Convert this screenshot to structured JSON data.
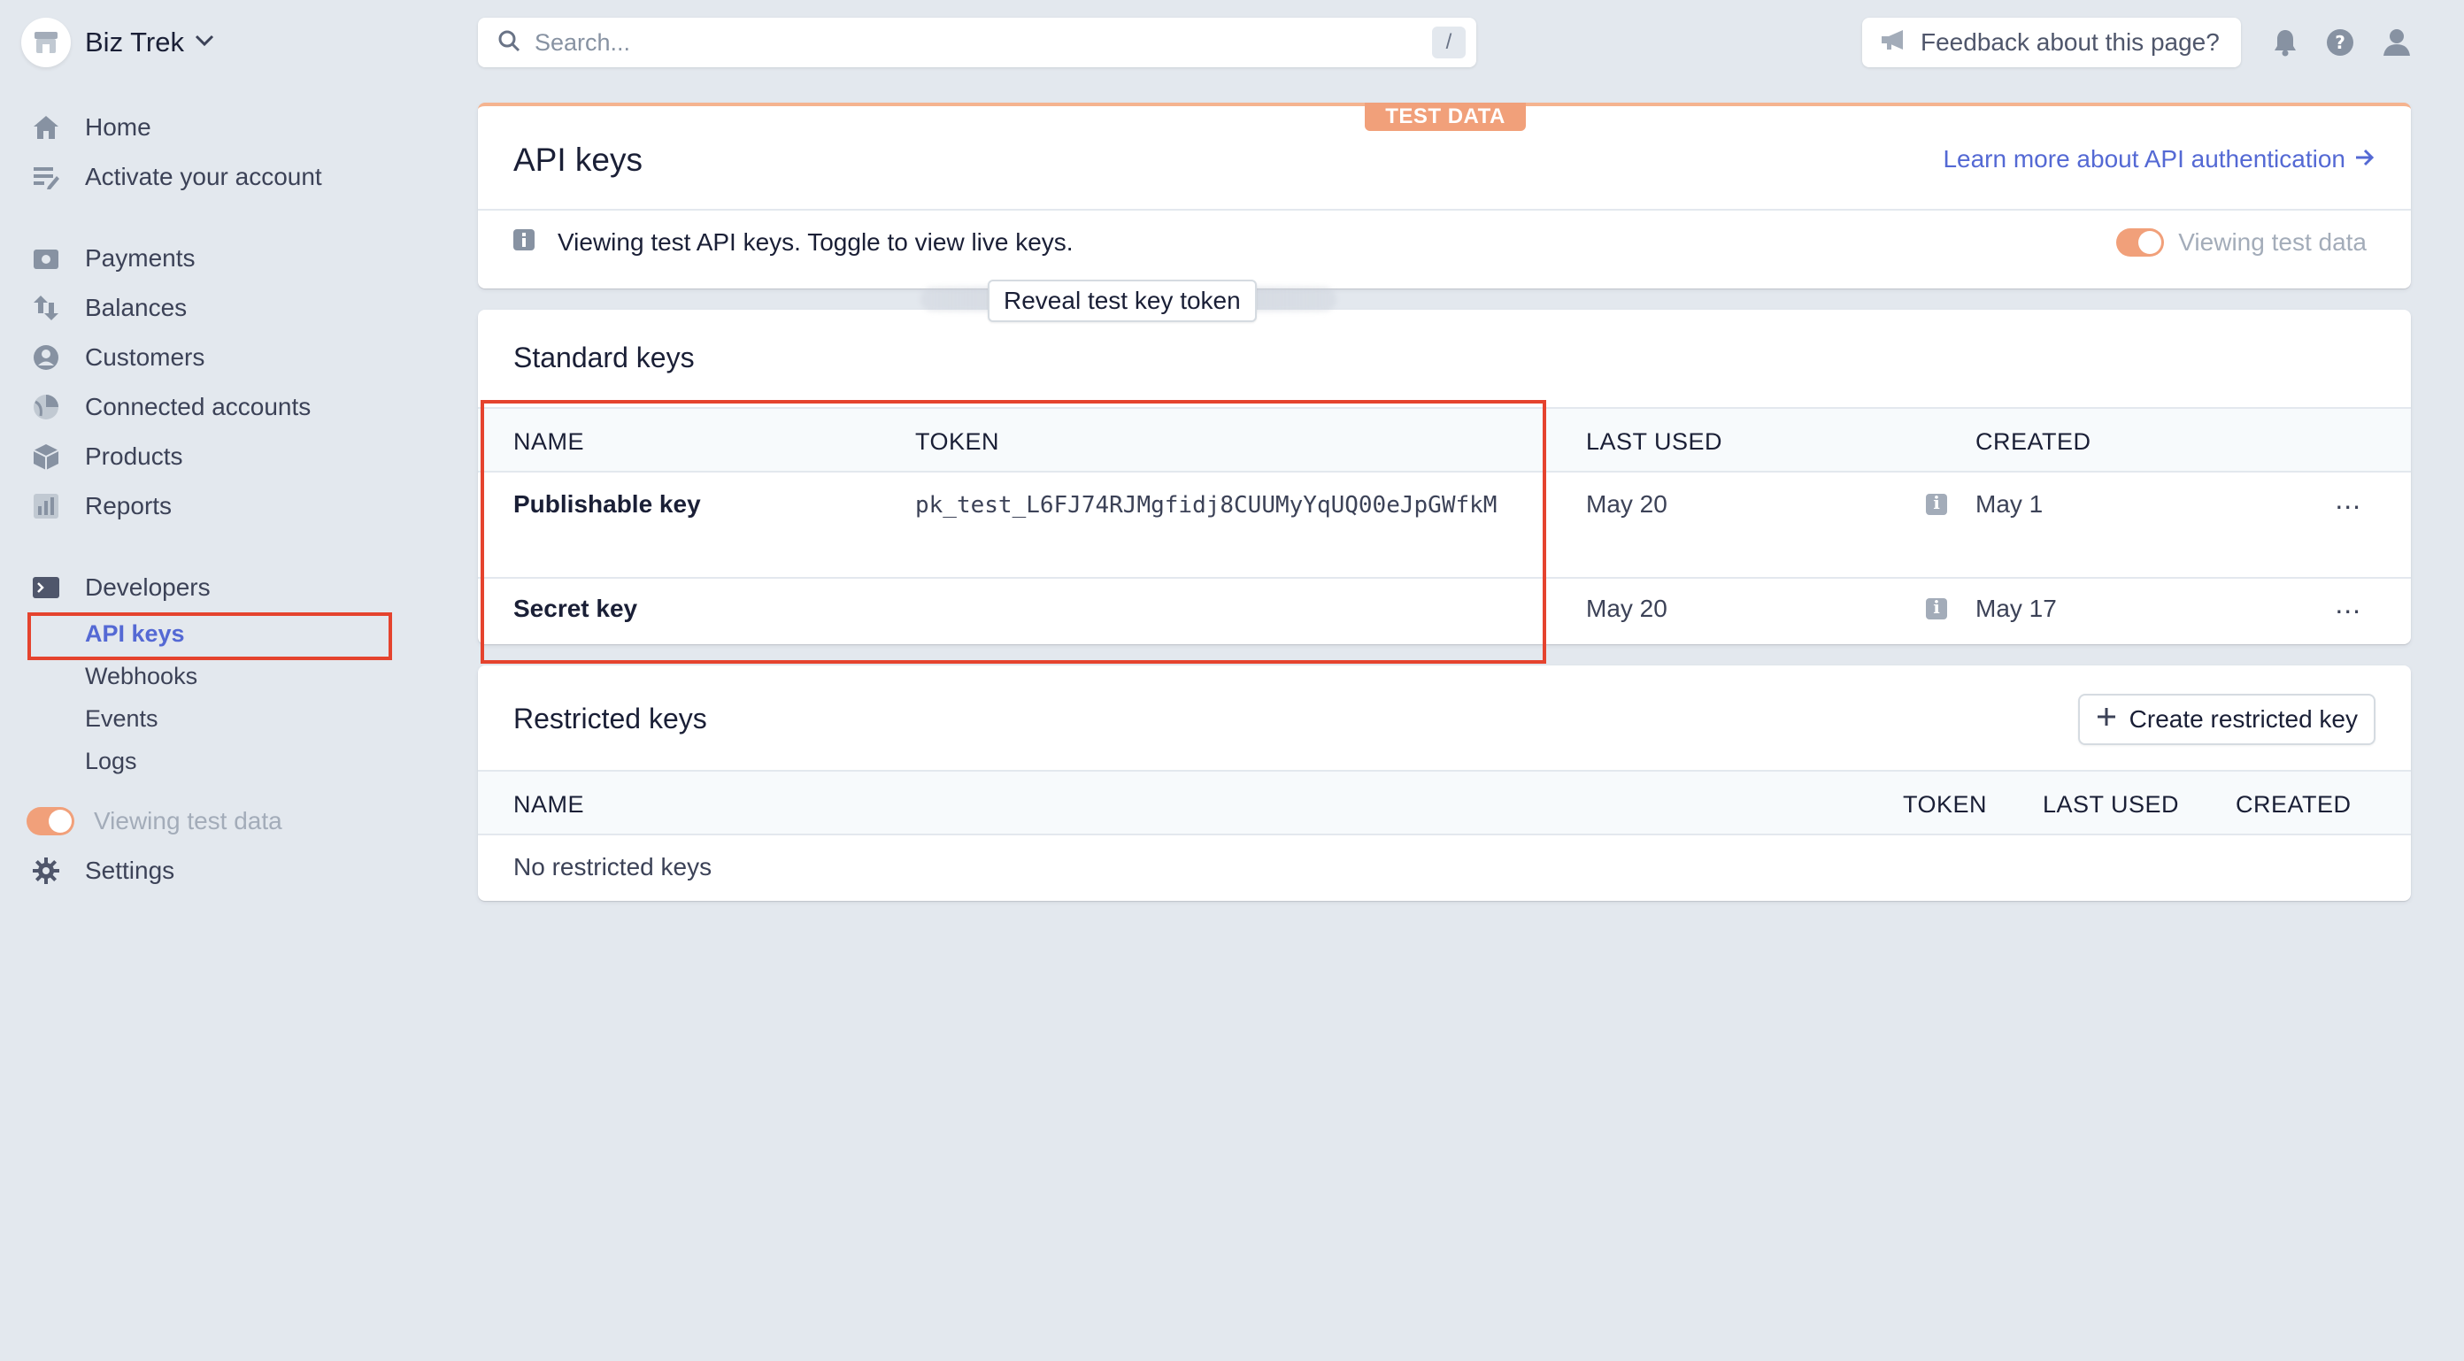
{
  "brand": {
    "name": "Biz Trek"
  },
  "nav": {
    "home": "Home",
    "activate": "Activate your account",
    "payments": "Payments",
    "balances": "Balances",
    "customers": "Customers",
    "connected": "Connected accounts",
    "products": "Products",
    "reports": "Reports",
    "developers": "Developers",
    "developer_items": [
      "API keys",
      "Webhooks",
      "Events",
      "Logs"
    ],
    "viewing_test_data": "Viewing test data",
    "settings": "Settings"
  },
  "search": {
    "placeholder": "Search...",
    "shortcut": "/"
  },
  "feedback": {
    "label": "Feedback about this page?"
  },
  "header_card": {
    "badge": "TEST DATA",
    "title": "API keys",
    "learn_link": "Learn more about API authentication",
    "info_text": "Viewing test API keys. Toggle to view live keys.",
    "toggle_label": "Viewing test data"
  },
  "standard_keys": {
    "title": "Standard keys",
    "columns": [
      "NAME",
      "TOKEN",
      "LAST USED",
      "CREATED"
    ],
    "rows": [
      {
        "name": "Publishable key",
        "token": "pk_test_L6FJ74RJMgfidj8CUUMyYqUQ00eJpGWfkM",
        "last_used": "May 20",
        "created": "May 1",
        "more": "..."
      },
      {
        "name": "Secret key",
        "token_button": "Reveal test key token",
        "last_used": "May 20",
        "created": "May 17",
        "more": "..."
      }
    ]
  },
  "restricted_keys": {
    "title": "Restricted keys",
    "create_button": "Create restricted key",
    "columns": [
      "NAME",
      "TOKEN",
      "LAST USED",
      "CREATED"
    ],
    "empty": "No restricted keys"
  },
  "colors": {
    "accent": "#5469d4",
    "test_orange": "#f1a07a",
    "highlight": "#e5432e"
  }
}
